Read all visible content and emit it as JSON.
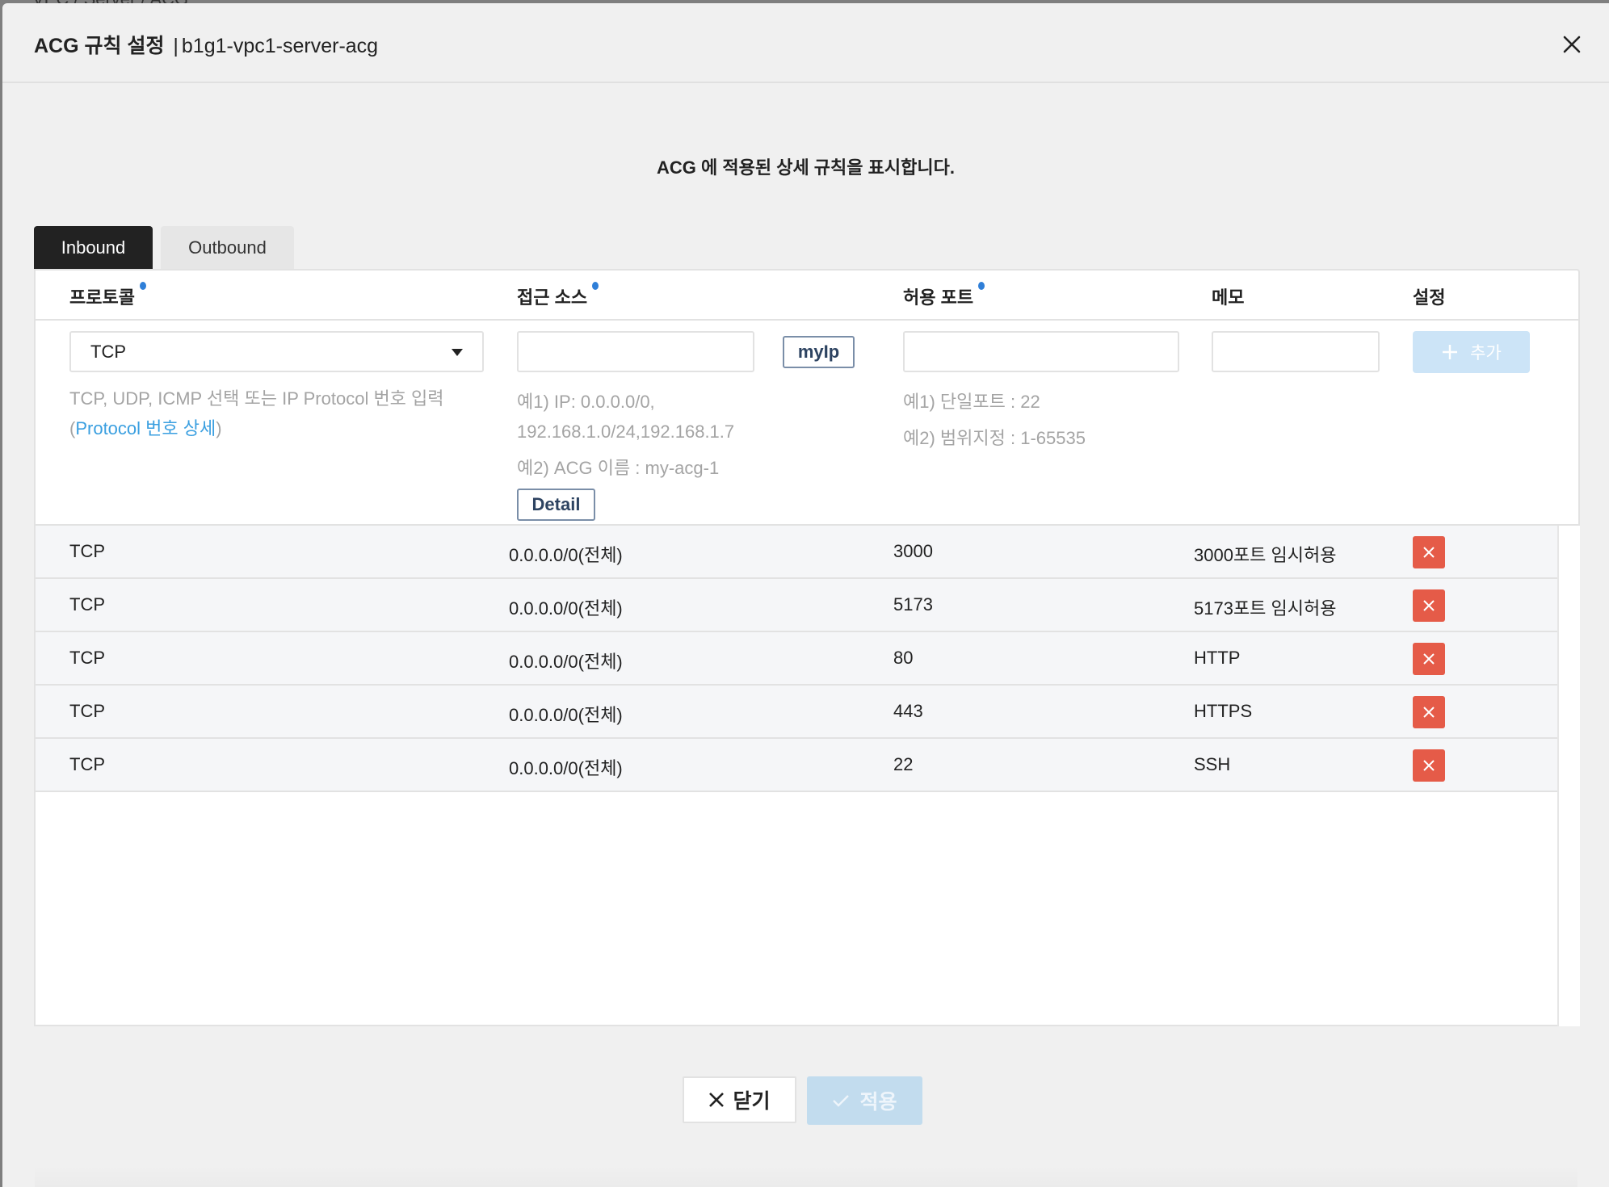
{
  "backdrop": {
    "breadcrumb": "VPC / Server / ACG"
  },
  "modal": {
    "title_bold": "ACG 규칙 설정",
    "title_separator": "|",
    "title_name": "b1g1-vpc1-server-acg",
    "close_icon": "close-icon",
    "description": "ACG 에 적용된 상세 규칙을 표시합니다."
  },
  "tabs": [
    {
      "label": "Inbound",
      "active": true
    },
    {
      "label": "Outbound",
      "active": false
    }
  ],
  "table": {
    "headers": [
      {
        "label": "프로토콜",
        "required": true
      },
      {
        "label": "접근 소스",
        "required": true
      },
      {
        "label": "허용 포트",
        "required": true
      },
      {
        "label": "메모",
        "required": false
      },
      {
        "label": "설정",
        "required": false
      }
    ],
    "form": {
      "protocol_selected": "TCP",
      "protocol_help": "TCP, UDP, ICMP 선택 또는 IP Protocol 번호 입력",
      "protocol_link_open": "(",
      "protocol_link": "Protocol 번호 상세",
      "protocol_link_close": ")",
      "source_value": "",
      "myip_button": "myIp",
      "source_help_1a": "예1) IP: 0.0.0.0/0,",
      "source_help_1b": "192.168.1.0/24,192.168.1.7",
      "source_help_2": "예2) ACG 이름 : my-acg-1",
      "detail_button": "Detail",
      "port_value": "",
      "port_help_1": "예1) 단일포트 : 22",
      "port_help_2": "예2) 범위지정 : 1-65535",
      "memo_value": "",
      "add_button": "추가"
    },
    "rows": [
      {
        "protocol": "TCP",
        "source": "0.0.0.0/0(전체)",
        "port": "3000",
        "memo": "3000포트 임시허용"
      },
      {
        "protocol": "TCP",
        "source": "0.0.0.0/0(전체)",
        "port": "5173",
        "memo": "5173포트 임시허용"
      },
      {
        "protocol": "TCP",
        "source": "0.0.0.0/0(전체)",
        "port": "80",
        "memo": "HTTP"
      },
      {
        "protocol": "TCP",
        "source": "0.0.0.0/0(전체)",
        "port": "443",
        "memo": "HTTPS"
      },
      {
        "protocol": "TCP",
        "source": "0.0.0.0/0(전체)",
        "port": "22",
        "memo": "SSH"
      }
    ]
  },
  "footer": {
    "close_button": "닫기",
    "apply_button": "적용"
  },
  "colors": {
    "active_tab": "#222222",
    "required_dot": "#2f7fd8",
    "link": "#3a9fe0",
    "delete_button": "#e55b48",
    "add_button_disabled": "#cce4f7",
    "apply_button_disabled": "#c2dcee"
  }
}
